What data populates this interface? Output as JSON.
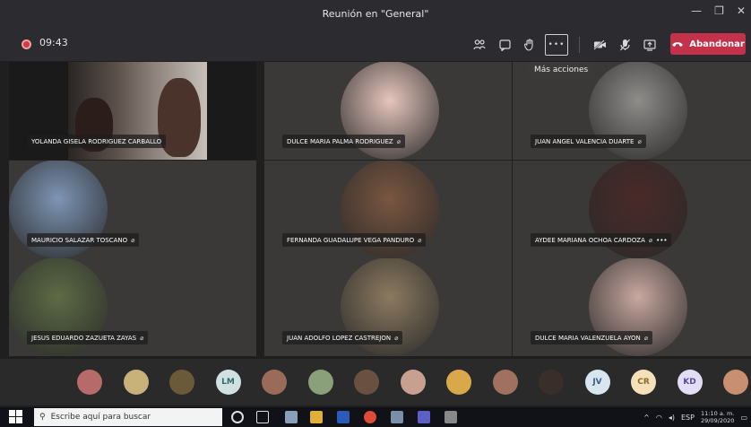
{
  "window": {
    "title": "Reunión en \"General\""
  },
  "toolbar": {
    "timer": "09:43",
    "leave_label": "Abandonar",
    "more_tooltip": "Más acciones",
    "more_glyph": "•••"
  },
  "participants": [
    {
      "name": "YOLANDA GISELA RODRIGUEZ CARBALLO",
      "muted": false,
      "video": true
    },
    {
      "name": "DULCE MARIA PALMA RODRIGUEZ",
      "muted": true,
      "color": "#e6c6bd"
    },
    {
      "name": "JUAN ANGEL VALENCIA DUARTE",
      "muted": true,
      "color": "#8f8d8a"
    },
    {
      "name": "MAURICIO SALAZAR TOSCANO",
      "muted": true,
      "color": "#7d95b5"
    },
    {
      "name": "FERNANDA GUADALUPE VEGA PANDURO",
      "muted": true,
      "color": "#7a5640"
    },
    {
      "name": "AYDEE MARIANA OCHOA CARDOZA",
      "muted": true,
      "color": "#4a2a28"
    },
    {
      "name": "JESUS EDUARDO ZAZUETA ZAYAS",
      "muted": true,
      "color": "#5d6b45"
    },
    {
      "name": "JUAN ADOLFO LOPEZ CASTREJON",
      "muted": true,
      "color": "#8c7a60"
    },
    {
      "name": "DULCE MARIA VALENZUELA AYON",
      "muted": true,
      "color": "#c9a8a0"
    }
  ],
  "tile_more_glyph": "•••",
  "strip": [
    {
      "initials": "",
      "color": "#b76a6a"
    },
    {
      "initials": "",
      "color": "#c8b27a"
    },
    {
      "initials": "",
      "color": "#6b5a3a"
    },
    {
      "initials": "LM",
      "color": "#cfe1e0",
      "text": "#2f6b6a"
    },
    {
      "initials": "",
      "color": "#9b6b5a"
    },
    {
      "initials": "",
      "color": "#8aa07a"
    },
    {
      "initials": "",
      "color": "#6a5040"
    },
    {
      "initials": "",
      "color": "#c8a090"
    },
    {
      "initials": "",
      "color": "#d9a84a"
    },
    {
      "initials": "",
      "color": "#a07060"
    },
    {
      "initials": "",
      "color": "#3a2e2a"
    },
    {
      "initials": "JV",
      "color": "#d8e6f0",
      "text": "#3a5f82"
    },
    {
      "initials": "CR",
      "color": "#f5e0b8",
      "text": "#8a6a2a"
    },
    {
      "initials": "KD",
      "color": "#e3def5",
      "text": "#5a4a9a"
    },
    {
      "initials": "",
      "color": "#c89070"
    }
  ],
  "taskbar": {
    "search_placeholder": "Escribe aquí para buscar",
    "lang": "ESP",
    "time": "11:10 a. m.",
    "date": "29/09/2020"
  },
  "colors": {
    "leave": "#c4314b",
    "chrome": "#2b2b30",
    "tile": "#3a3938"
  }
}
